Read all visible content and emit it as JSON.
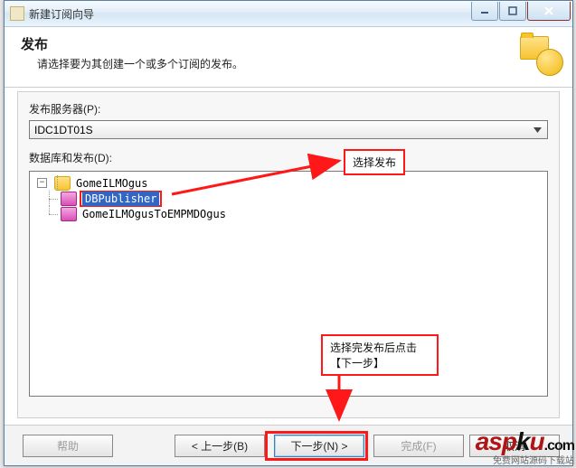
{
  "window": {
    "title": "新建订阅向导"
  },
  "header": {
    "title": "发布",
    "subtitle": "请选择要为其创建一个或多个订阅的发布。"
  },
  "fields": {
    "server_label": "发布服务器(P):",
    "server_value": "IDC1DT01S",
    "tree_label": "数据库和发布(D):"
  },
  "tree": {
    "db": "GomeILMOgus",
    "pub_selected": "DBPublisher",
    "pub_other": "GomeILMOgusToEMPMDOgus"
  },
  "buttons": {
    "help": "帮助",
    "back": "< 上一步(B)",
    "next": "下一步(N) >",
    "finish": "完成(F)",
    "cancel": "取消"
  },
  "annotations": {
    "select_pub": "选择发布",
    "click_next": "选择完发布后点击【下一步】"
  },
  "watermark": {
    "main_a": "asp",
    "main_k": "k",
    "main_u": "u",
    "dotcom": ".com",
    "sub": "免费网站源码下载站"
  }
}
